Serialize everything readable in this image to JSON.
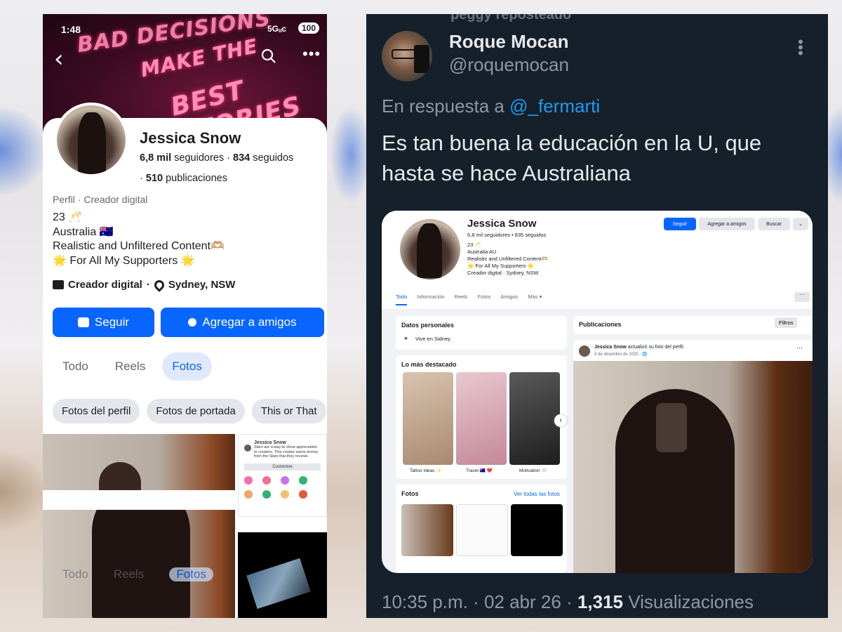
{
  "phone": {
    "status": {
      "time": "1:48",
      "network": "5Gᵤc",
      "battery": "100"
    },
    "cover_words": [
      "BAD DECISIONS",
      "MAKE THE",
      "BEST STORIES"
    ],
    "profile": {
      "name": "Jessica Snow",
      "followers_count": "6,8 mil",
      "followers_label": "seguidores",
      "following_count": "834",
      "following_label": "seguidos",
      "posts_count": "510",
      "posts_label": "publicaciones",
      "category": "Perfil · Creador digital",
      "bio": [
        "23 🥂",
        "Australia 🇦🇺",
        "Realistic and Unfiltered Content🫶🏼",
        "🌟 For All My Supporters 🌟"
      ],
      "category_badge": "Creador digital",
      "location": "Sydney, NSW"
    },
    "buttons": {
      "follow": "Seguir",
      "add_friend": "Agregar a amigos"
    },
    "tabs": [
      {
        "label": "Todo",
        "active": false
      },
      {
        "label": "Reels",
        "active": false
      },
      {
        "label": "Fotos",
        "active": true
      }
    ],
    "chips": [
      "Fotos del perfil",
      "Fotos de portada",
      "This or That"
    ],
    "thumb": {
      "name": "Jessica Snow",
      "text": "Stars are a way to show appreciation to creators. This creator earns money from the Stars that they receive.",
      "button": "Customise"
    }
  },
  "tweet": {
    "reposted": "peggy reposteado",
    "author_name": "Roque Mocan",
    "author_handle": "@roquemocan",
    "reply_prefix": "En respuesta a",
    "reply_to": "@_fermarti",
    "text": "Es tan buena la educación en la U, que hasta se hace Australiana",
    "time_date": "10:35 p.m. · 02 abr 26 ·",
    "views_count": "1,315",
    "views_label": "Visualizaciones"
  },
  "embed": {
    "name": "Jessica Snow",
    "stats": "6,8 mil seguidores • 835 seguidos",
    "lines": [
      "23 🥂",
      "Australia AU",
      "Realistic and Unfiltered Content🫶🏼",
      "🌟 For All My Supporters 🌟",
      "Creador digital · Sydney, NSW"
    ],
    "buttons": [
      "Seguir",
      "Agregar a amigos",
      "Buscar"
    ],
    "tabs": [
      "Todo",
      "Información",
      "Reels",
      "Fotos",
      "Amigos",
      "Más ▾"
    ],
    "personal_title": "Datos personales",
    "lives_in": "Vive en Sidney",
    "highlights_title": "Lo más destacado",
    "highlights": [
      "Tattoo Ideas ✨",
      "Travel 🇦🇺 ❤️",
      "Motivation 🤍"
    ],
    "photos_title": "Fotos",
    "photos_link": "Ver todas las fotos",
    "posts_title": "Publicaciones",
    "filters": "Filtros",
    "post_author": "Jessica Snow",
    "post_action": "actualizó su foto del perfil.",
    "post_date": "4 de diciembre de 2025 · 🌐"
  },
  "colors": {
    "fb_blue": "#0866ff",
    "tweet_bg": "#15202b",
    "tweet_link": "#1d9bf0"
  }
}
